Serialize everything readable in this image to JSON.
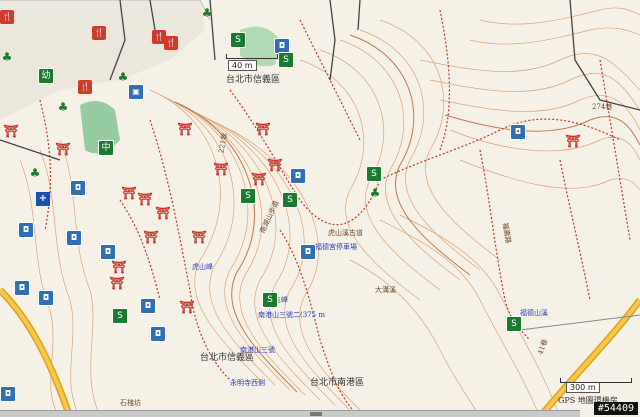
{
  "map": {
    "labels": {
      "district_top": "台北市信義區",
      "district_bottom": "台北市信義區",
      "district_nangang": "台北市南港區",
      "village": "大溝溪",
      "road_221": "221巷",
      "road_274": "274巷",
      "road_41": "41巷",
      "road_nanhu": "南湖山步道",
      "trail_9wu": "九五峰",
      "trail_sanfang": "南港山三號二(375 m",
      "trail_huadonglu": "虎山峰",
      "poi_upper": "虎山溪古道",
      "poi_middle": "福德宮停車場",
      "poi_right": "福德山溪",
      "poi_lower": "南港山三號",
      "poi_bottom": "永明寺西側",
      "bottom_road": "石棧坊",
      "road_dong": "福壽路"
    },
    "scale_top": "40 m",
    "scale_bottom": "300 m",
    "watermark": "GPS 地圖環機房",
    "badge": "#54409"
  }
}
